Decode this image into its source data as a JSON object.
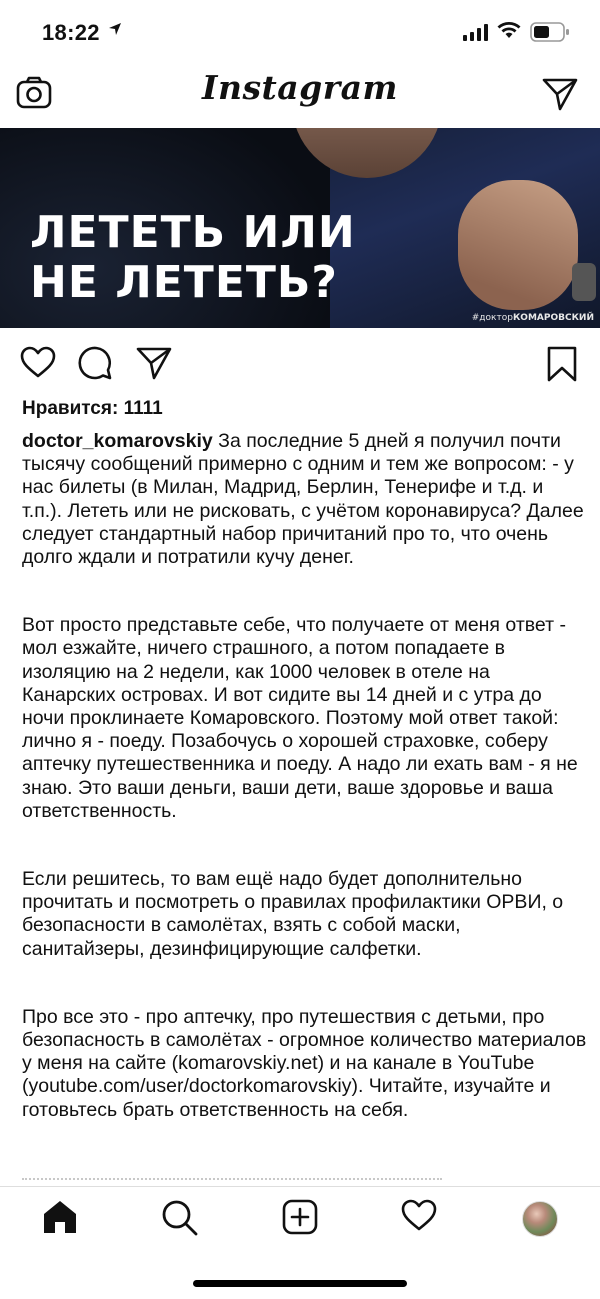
{
  "status_bar": {
    "time": "18:22",
    "signal_bars": 4,
    "wifi": true,
    "battery_level": 0.5
  },
  "header": {
    "logo": "Instagram",
    "left_icon": "camera-icon",
    "right_icon": "direct-send-icon"
  },
  "post_image": {
    "headline_line1": "ЛЕТЕТЬ ИЛИ",
    "headline_line2": "НЕ ЛЕТЕТЬ?",
    "tag_prefix": "#доктор",
    "tag_name": "КОМАРОВСКИЙ"
  },
  "actions": {
    "icons": [
      "heart-icon",
      "comment-icon",
      "share-icon",
      "bookmark-icon"
    ]
  },
  "likes": "Нравится: 1111",
  "caption": {
    "username": "doctor_komarovskiy",
    "paragraph1": "За последние 5 дней я получил почти тысячу сообщений примерно с одним и тем же вопросом: - у нас билеты (в Милан, Мадрид, Берлин, Тенерифе и т.д. и т.п.). Лететь или не рисковать, с учётом коронавируса? Далее следует стандартный набор причитаний про то, что очень долго ждали и потратили кучу денег.",
    "paragraph2": "Вот просто представьте себе, что получаете от меня ответ - мол езжайте, ничего страшного, а потом попадаете в изоляцию на 2 недели, как 1000 человек в отеле на Канарских островах. И вот сидите вы 14 дней и с утра до ночи проклинаете Комаровского. Поэтому мой ответ такой: лично я - поеду. Позабочусь о хорошей страховке, соберу аптечку путешественника и поеду. А надо ли ехать вам - я не знаю. Это ваши деньги, ваши дети, ваше здоровье и ваша ответственность.",
    "paragraph3": "Если решитесь, то вам ещё надо будет дополнительно прочитать и посмотреть о правилах профилактики ОРВИ, о безопасности в самолётах, взять с собой маски, санитайзеры, дезинфицирующие салфетки.",
    "paragraph4": "Про все это - про аптечку, про путешествия с детьми, про безопасность в самолётах - огромное количество материалов у меня на сайте (komarovskiy.net) и на канале в YouTube (youtube.com/user/doctorkomarovskiy). Читайте, изучайте и готовьтесь брать ответственность на себя."
  },
  "bottom_nav": {
    "items": [
      "home-icon",
      "search-icon",
      "new-post-icon",
      "activity-icon",
      "profile-avatar"
    ]
  }
}
